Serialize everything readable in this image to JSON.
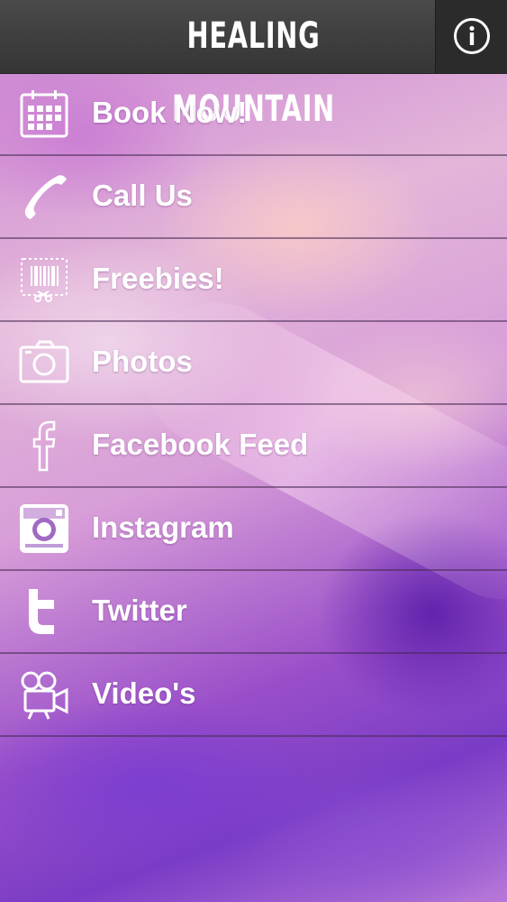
{
  "header": {
    "title": "HEALING MOUNTAIN",
    "info_icon": "info-circle-icon"
  },
  "menu": {
    "items": [
      {
        "label": "Book Now!",
        "icon": "calendar-icon"
      },
      {
        "label": "Call Us",
        "icon": "phone-icon"
      },
      {
        "label": "Freebies!",
        "icon": "coupon-icon"
      },
      {
        "label": "Photos",
        "icon": "camera-icon"
      },
      {
        "label": "Facebook Feed",
        "icon": "facebook-icon"
      },
      {
        "label": "Instagram",
        "icon": "instagram-icon"
      },
      {
        "label": "Twitter",
        "icon": "twitter-icon"
      },
      {
        "label": "Video's",
        "icon": "video-camera-icon"
      }
    ]
  },
  "colors": {
    "header_bg": "#3d3d3d",
    "text": "#ffffff",
    "background_accent": "#9a5cc4"
  }
}
